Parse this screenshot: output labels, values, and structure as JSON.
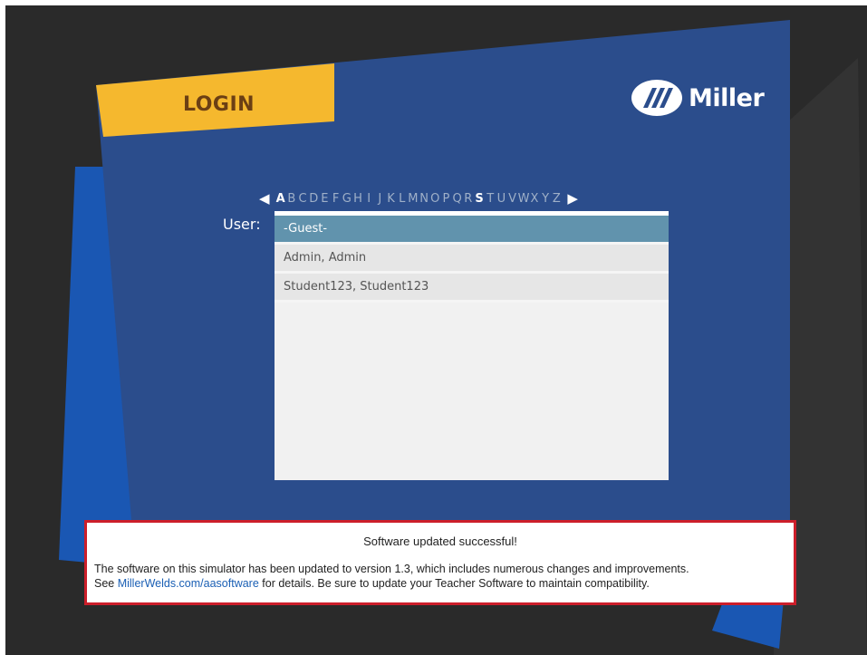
{
  "screen": {
    "title": "LOGIN",
    "logo_text": "Miller",
    "colors": {
      "background": "#2a2a2a",
      "panel_blue": "#2b4d8c",
      "accent_blue": "#1a57b3",
      "tab_yellow": "#f5b82e",
      "selection": "#6193ad",
      "notice_border": "#cc1e2a",
      "link": "#1a5fb4"
    }
  },
  "alphabet": {
    "prev_icon": "left-arrow-icon",
    "next_icon": "right-arrow-icon",
    "prev_glyph": "◀",
    "next_glyph": "▶",
    "letters": [
      "A",
      "B",
      "C",
      "D",
      "E",
      "F",
      "G",
      "H",
      "I",
      "J",
      "K",
      "L",
      "M",
      "N",
      "O",
      "P",
      "Q",
      "R",
      "S",
      "T",
      "U",
      "V",
      "W",
      "X",
      "Y",
      "Z"
    ],
    "active": [
      "A",
      "S"
    ]
  },
  "users": {
    "label": "User:",
    "items": [
      "-Guest-",
      "Admin, Admin",
      "Student123, Student123"
    ],
    "selected_index": 0
  },
  "notice": {
    "title": "Software updated successful!",
    "line1": "The software on this simulator has been updated to version 1.3, which includes numerous changes and improvements.",
    "line2_prefix": "See ",
    "link_text": "MillerWelds.com/aasoftware",
    "line2_suffix": " for details. Be sure to update your Teacher Software to maintain compatibility."
  }
}
